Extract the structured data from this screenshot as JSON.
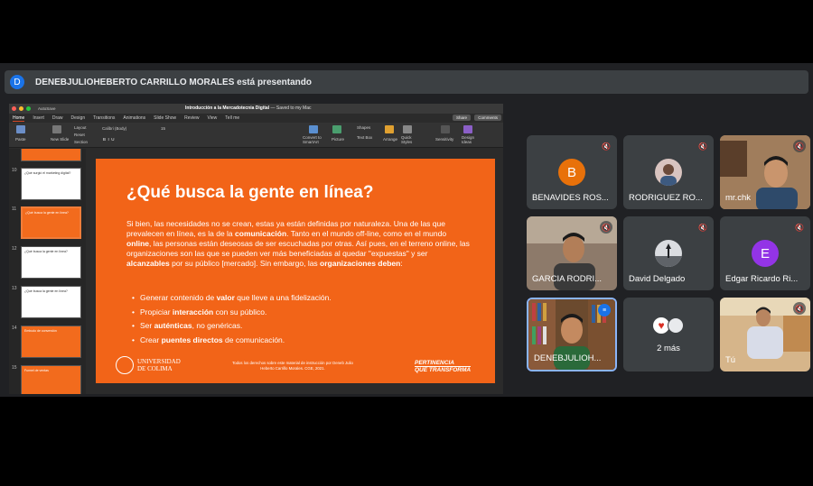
{
  "presenter": {
    "initial": "D",
    "text": "DENEBJULIOHEBERTO CARRILLO MORALES está presentando"
  },
  "ppt": {
    "autosave": "AutoSave",
    "doc_title": "Introducción a la Mercadotecnia Digital",
    "saved": "— Saved to my Mac",
    "tabs": [
      "Home",
      "Insert",
      "Draw",
      "Design",
      "Transitions",
      "Animations",
      "Slide Show",
      "Review",
      "View",
      "Tell me"
    ],
    "share": "Share",
    "comments": "Comments",
    "ribbon": {
      "paste": "Paste",
      "new_slide": "New Slide",
      "layout": "Layout",
      "reset": "Reset",
      "section": "Section",
      "font": "Calibri (Body)",
      "font_size": "15",
      "convert": "Convert to SmartArt",
      "picture": "Picture",
      "shapes": "Shapes",
      "textbox": "Text Box",
      "arrange": "Arrange",
      "quick_styles": "Quick Styles",
      "sensitivity": "Sensitivity",
      "design_ideas": "Design Ideas"
    },
    "thumbnails": [
      {
        "num": "",
        "title": ""
      },
      {
        "num": "10",
        "title": "¿Qué surgió el marketing digital?"
      },
      {
        "num": "11",
        "title": "¿Qué busca la gente en línea?"
      },
      {
        "num": "12",
        "title": "¿Qué busca la gente en línea?"
      },
      {
        "num": "13",
        "title": "¿Qué busca la gente en línea?"
      },
      {
        "num": "14",
        "title": "Embudo de conversión"
      },
      {
        "num": "15",
        "title": "Funnel de ventas"
      }
    ],
    "slide": {
      "title": "¿Qué busca la gente en línea?",
      "p1": "Si bien, las necesidades no se crean, estas ya están definidas por naturaleza. Una de las que prevalecen en línea, es la de la ",
      "p1b": "comunicación",
      "p2": ". Tanto en el mundo off-line, como en el mundo ",
      "p2b": "online",
      "p3": ", las personas están deseosas de ser escuchadas por otras. Así pues, en el terreno online, las organizaciones son las que se pueden ver más beneficiadas al quedar \"expuestas\" y ser ",
      "p3b": "alcanzables",
      "p4": " por su público [mercado]. Sin embargo, las ",
      "p4b": "organizaciones deben",
      "p5": ":",
      "bullets": [
        {
          "pre": "Generar contenido de ",
          "bold": "valor",
          "post": " que lleve a una fidelización."
        },
        {
          "pre": "Propiciar ",
          "bold": "interacción",
          "post": " con su público."
        },
        {
          "pre": "Ser ",
          "bold": "auténticas",
          "post": ", no genéricas."
        },
        {
          "pre": "Crear ",
          "bold": "puentes directos",
          "post": " de comunicación."
        }
      ],
      "logo_line1": "UNIVERSIDAD",
      "logo_line2": "DE COLIMA",
      "footer": "Todos los derechos sobre este material de instrucción por Deneb Julio Heberto Carrillo Morales. CGE, 2021.",
      "brand1": "PERTINENCIA",
      "brand2": "QUE TRANSFORMA"
    }
  },
  "participants": [
    {
      "name": "BENAVIDES ROS...",
      "initial": "B",
      "color": "#e8710a",
      "muted": true
    },
    {
      "name": "RODRIGUEZ RO...",
      "initial": "",
      "color": "#c8c8c8",
      "muted": true
    },
    {
      "name": "mr.chk",
      "initial": "",
      "color": "",
      "muted": true
    },
    {
      "name": "GARCIA RODRI...",
      "initial": "",
      "color": "",
      "muted": true
    },
    {
      "name": "David Delgado",
      "initial": "",
      "color": "#dadce0",
      "muted": true
    },
    {
      "name": "Edgar Ricardo Ri...",
      "initial": "E",
      "color": "#9334e6",
      "muted": true
    },
    {
      "name": "DENEBJULIOH...",
      "initial": "",
      "color": "",
      "muted": false
    },
    {
      "name": "2 más",
      "initial": "",
      "color": "",
      "muted": false
    },
    {
      "name": "Tú",
      "initial": "",
      "color": "",
      "muted": true
    }
  ]
}
